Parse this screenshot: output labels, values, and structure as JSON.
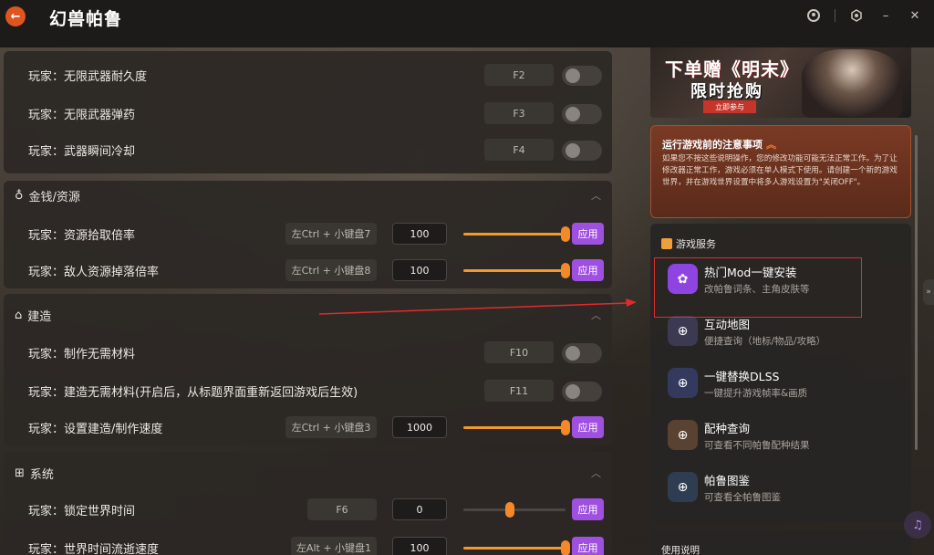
{
  "app": {
    "title": "幻兽帕鲁",
    "back_icon": "arrow-left-icon",
    "window_controls": [
      "user-icon",
      "settings-icon",
      "minimize-icon",
      "close-icon"
    ]
  },
  "weapons_rows": [
    {
      "label": "玩家：无限武器耐久度",
      "hotkey": "F2"
    },
    {
      "label": "玩家：无限武器弹药",
      "hotkey": "F3"
    },
    {
      "label": "玩家：武器瞬间冷却",
      "hotkey": "F4"
    }
  ],
  "money": {
    "title": "金钱/资源",
    "rows": [
      {
        "label": "玩家：资源拾取倍率",
        "hotkey": "左Ctrl + 小键盘7",
        "value": "100",
        "apply": "应用"
      },
      {
        "label": "玩家：敌人资源掉落倍率",
        "hotkey": "左Ctrl + 小键盘8",
        "value": "100",
        "apply": "应用"
      }
    ]
  },
  "build": {
    "title": "建造",
    "rows": [
      {
        "label": "玩家：制作无需材料",
        "hotkey": "F10"
      },
      {
        "label": "玩家：建造无需材料(开启后，从标题界面重新返回游戏后生效)",
        "hotkey": "F11"
      },
      {
        "label": "玩家：设置建造/制作速度",
        "hotkey": "左Ctrl + 小键盘3",
        "value": "1000",
        "apply": "应用"
      }
    ]
  },
  "system": {
    "title": "系统",
    "rows": [
      {
        "label": "玩家：锁定世界时间",
        "hotkey": "F6",
        "value": "0",
        "apply": "应用"
      },
      {
        "label": "玩家：世界时间流逝速度",
        "hotkey": "左Alt + 小键盘1",
        "value": "100",
        "apply": "应用"
      }
    ]
  },
  "banner": {
    "line1": "下单赠《明末》",
    "line2": "限时抢购",
    "button": "立即参与"
  },
  "notice": {
    "title": "运行游戏前的注意事项",
    "body": "如果您不按这些说明操作，您的修改功能可能无法正常工作。为了让修改器正常工作，游戏必须在单人模式下使用。请创建一个新的游戏世界，并在游戏世界设置中将多人游戏设置为\"关闭OFF\"。"
  },
  "services": {
    "title": "游戏服务",
    "items": [
      {
        "title": "热门Mod一键安装",
        "subtitle": "改帕鲁词条、主角皮肤等",
        "icon": "mod-icon",
        "color": "#8e44e0"
      },
      {
        "title": "互动地图",
        "subtitle": "便捷查询（地标/物品/攻略）",
        "icon": "download-icon",
        "color": "#3c3a52"
      },
      {
        "title": "一键替换DLSS",
        "subtitle": "一键提升游戏帧率&画质",
        "icon": "download-icon",
        "color": "#343a5e"
      },
      {
        "title": "配种查询",
        "subtitle": "可查看不同帕鲁配种结果",
        "icon": "download-icon",
        "color": "#5a4232"
      },
      {
        "title": "帕鲁图鉴",
        "subtitle": "可查看全帕鲁图鉴",
        "icon": "download-icon",
        "color": "#2f3d52"
      }
    ]
  },
  "usage": {
    "title": "使用说明"
  },
  "colors": {
    "accent": "#a050e0",
    "slider": "#f39a2b",
    "highlight": "#e12b2b"
  }
}
